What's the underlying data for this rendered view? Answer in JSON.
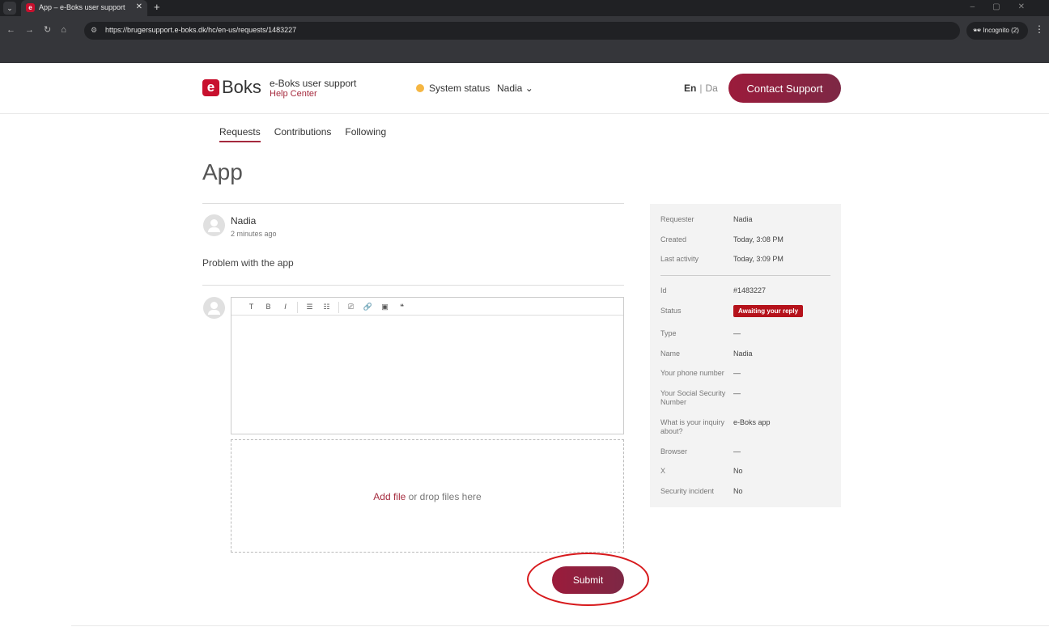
{
  "browser": {
    "tab_title": "App – e-Boks user support",
    "tab_favicon": "e",
    "url": "https://brugersupport.e-boks.dk/hc/en-us/requests/1483227",
    "incognito_label": "Incognito (2)"
  },
  "header": {
    "logo_e": "e",
    "logo_text": "Boks",
    "site_title": "e-Boks user support",
    "site_subtitle": "Help Center",
    "system_status": "System status",
    "user_name": "Nadia",
    "lang_en": "En",
    "lang_sep": "|",
    "lang_da": "Da",
    "contact_button": "Contact Support",
    "status_color": "#f5b642",
    "accent_color": "#a52a3d"
  },
  "subnav": {
    "requests": "Requests",
    "contributions": "Contributions",
    "following": "Following"
  },
  "request": {
    "title": "App",
    "author": "Nadia",
    "time": "2 minutes ago",
    "comment": "Problem with the app"
  },
  "editor": {
    "toolbar": {
      "text": "T",
      "bold": "B",
      "italic": "I",
      "bulleted_list": "☰",
      "numbered_list": "☷",
      "code": "⎚",
      "link": "🔗",
      "image": "▣",
      "quote": "❝"
    },
    "add_file": "Add file",
    "drop_text": " or drop files here",
    "submit_button": "Submit"
  },
  "details": {
    "requester_label": "Requester",
    "requester": "Nadia",
    "created_label": "Created",
    "created": "Today, 3:08 PM",
    "last_activity_label": "Last activity",
    "last_activity": "Today, 3:09 PM",
    "id_label": "Id",
    "id": "#1483227",
    "status_label": "Status",
    "status": "Awaiting your reply",
    "type_label": "Type",
    "type": "—",
    "name_label": "Name",
    "name": "Nadia",
    "phone_label": "Your phone number",
    "phone": "—",
    "ssn_label": "Your Social Security Number",
    "ssn": "—",
    "inquiry_label": "What is your inquiry about?",
    "inquiry": "e-Boks app",
    "browser_label": "Browser",
    "browser": "—",
    "x_label": "X",
    "x": "No",
    "security_label": "Security incident",
    "security": "No"
  }
}
